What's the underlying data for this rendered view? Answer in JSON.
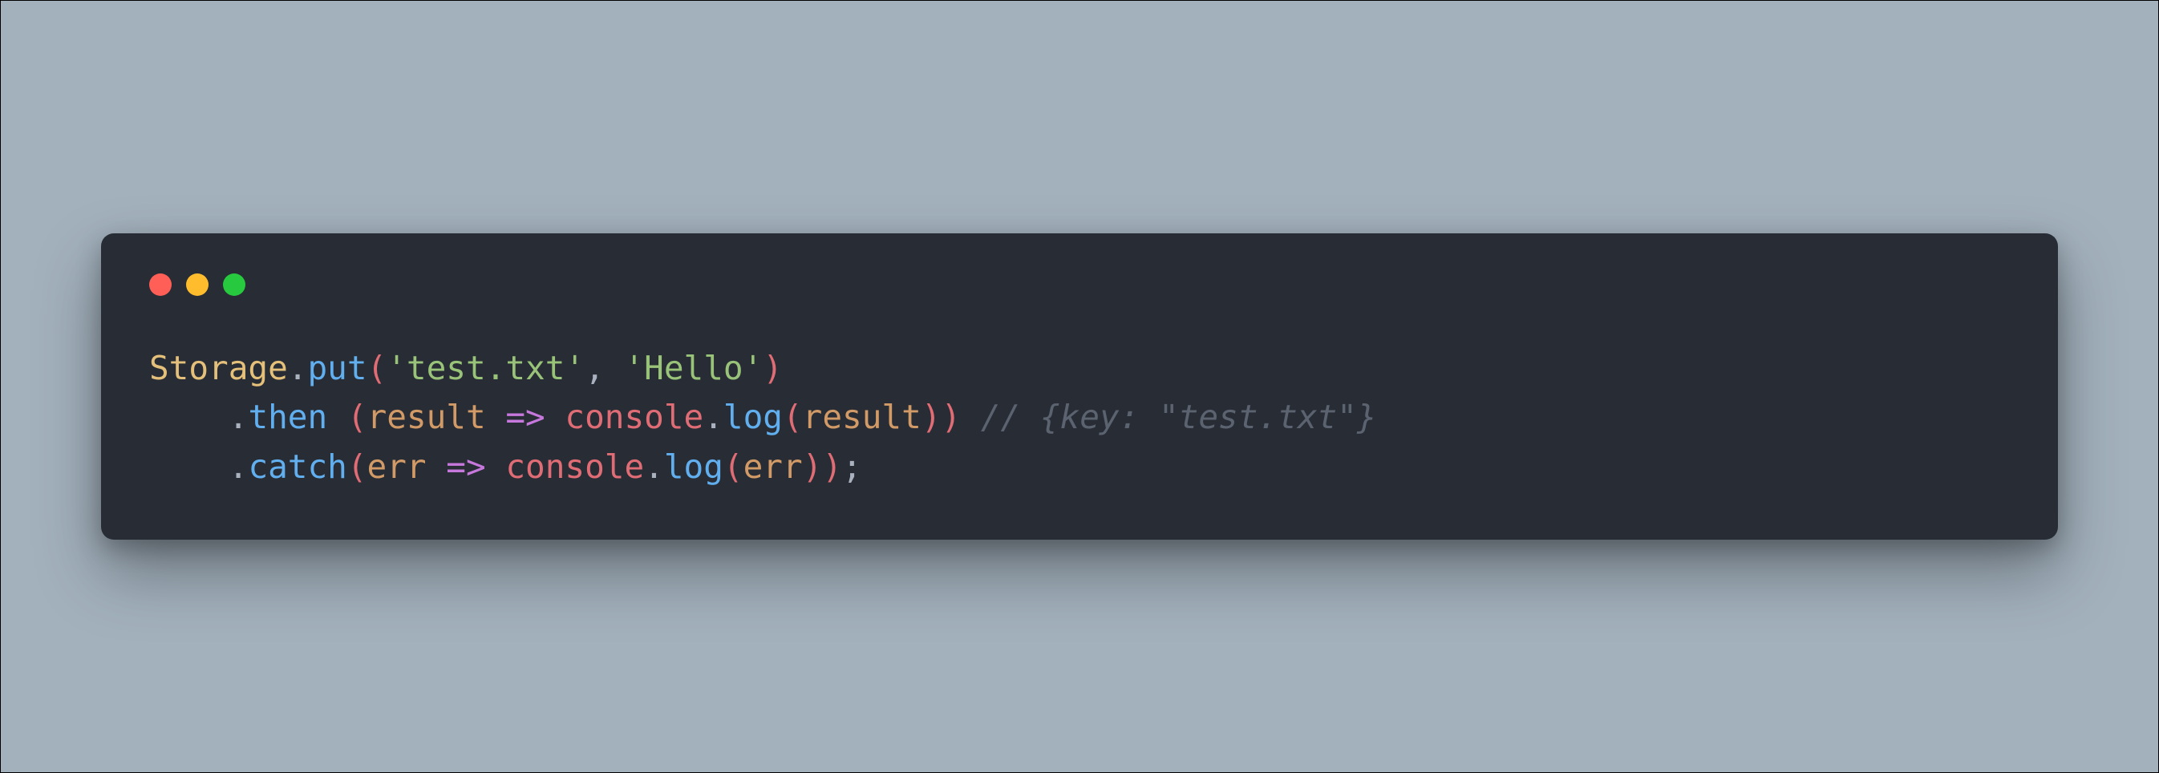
{
  "colors": {
    "close": "#ff5f56",
    "minimize": "#ffbd2e",
    "zoom": "#27c93f",
    "background": "#282c34",
    "page": "#a3b1bd"
  },
  "code": {
    "line1": {
      "class": "Storage",
      "dot1": ".",
      "method": "put",
      "paren1": "(",
      "str1": "'test.txt'",
      "comma": ", ",
      "str2": "'Hello'",
      "paren2": ")"
    },
    "line2": {
      "indent": "    ",
      "dot": ".",
      "method": "then",
      "space": " ",
      "paren1": "(",
      "param": "result",
      "arrow": " => ",
      "obj": "console",
      "dot2": ".",
      "method2": "log",
      "paren2": "(",
      "arg": "result",
      "paren3": ")",
      "paren4": ")",
      "comment": " // {key: \"test.txt\"}"
    },
    "line3": {
      "indent": "    ",
      "dot": ".",
      "method": "catch",
      "paren1": "(",
      "param": "err",
      "arrow": " => ",
      "obj": "console",
      "dot2": ".",
      "method2": "log",
      "paren2": "(",
      "arg": "err",
      "paren3": ")",
      "paren4": ")",
      "semi": ";"
    }
  }
}
